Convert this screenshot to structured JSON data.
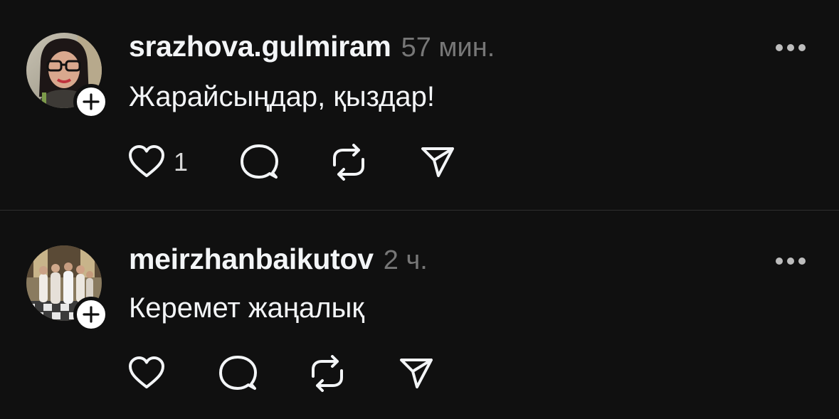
{
  "posts": [
    {
      "username": "srazhova.gulmiram",
      "time": "57 мин.",
      "text": "Жарайсыңдар, қыздар!",
      "like_count": "1",
      "avatar": "woman-with-glasses-photo",
      "icons": [
        "plus-icon",
        "more-dots-icon",
        "heart-icon",
        "comment-bubble-icon",
        "repost-icon",
        "send-icon"
      ]
    },
    {
      "username": "meirzhanbaikutov",
      "time": "2 ч.",
      "text": "Керемет жаңалық",
      "like_count": "",
      "avatar": "group-photo",
      "icons": [
        "plus-icon",
        "more-dots-icon",
        "heart-icon",
        "comment-bubble-icon",
        "repost-icon",
        "send-icon"
      ]
    }
  ],
  "colors": {
    "background": "#101010",
    "primary_text": "#f3f5f7",
    "secondary_text": "#777777",
    "divider": "#2e2e2e",
    "badge": "#ffffff"
  }
}
